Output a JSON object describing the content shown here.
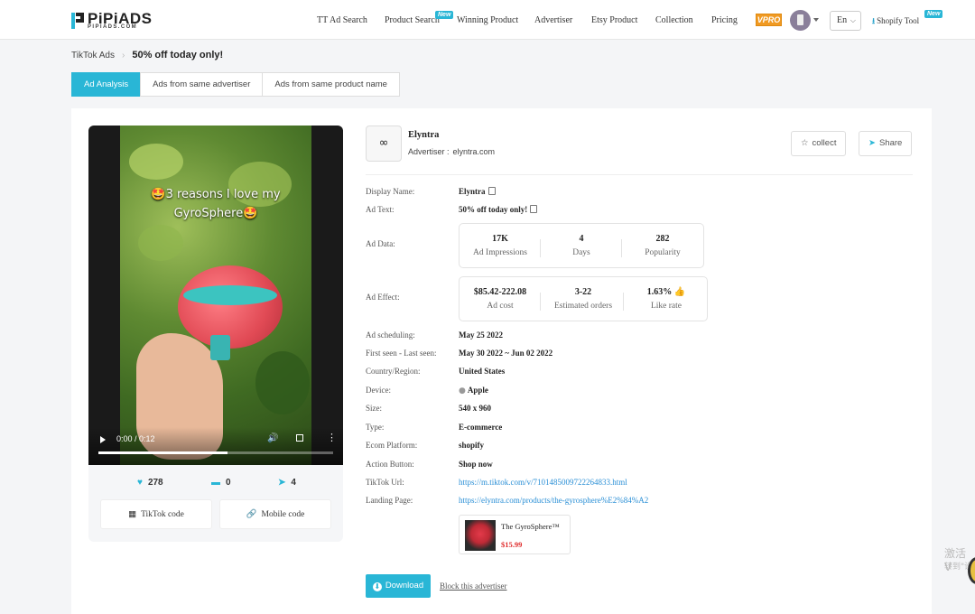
{
  "brand": {
    "name": "PiPiADS",
    "sub": "PIPIADS.COM"
  },
  "nav": {
    "items": [
      "TT Ad Search",
      "Product Search",
      "Winning Product",
      "Advertiser",
      "Etsy Product",
      "Collection",
      "Pricing"
    ],
    "new_badge": "New",
    "vip_label": "VPRO",
    "lang": "En",
    "lang_caret": "⌵",
    "shopify_label": "Shopify Tool",
    "shopify_new": "New"
  },
  "breadcrumb": {
    "root": "TikTok Ads",
    "separator": "›",
    "current": "50% off today only!"
  },
  "tabs": [
    "Ad Analysis",
    "Ads from same advertiser",
    "Ads from same product name"
  ],
  "video": {
    "caption_line1": "🤩3 reasons I love my",
    "caption_line2": "GyroSphere🤩",
    "time": "0:00 / 0:12",
    "progress": 0.55
  },
  "engagement": {
    "likes": "278",
    "comments": "0",
    "shares": "4"
  },
  "code_buttons": {
    "tiktok": "TikTok code",
    "mobile": "Mobile code"
  },
  "advertiser": {
    "logo_glyph": "∞",
    "name": "Elyntra",
    "label": "Advertiser :",
    "domain": "elyntra.com"
  },
  "actions": {
    "collect": "collect",
    "share": "Share"
  },
  "details": {
    "display_name_label": "Display Name:",
    "display_name": "Elyntra",
    "ad_text_label": "Ad Text:",
    "ad_text": "50% off today only!",
    "ad_data_label": "Ad Data:",
    "ad_effect_label": "Ad Effect:",
    "scheduling_label": "Ad scheduling:",
    "scheduling": "May 25 2022",
    "seen_label": "First seen - Last seen:",
    "seen": "May 30 2022 ~ Jun 02 2022",
    "country_label": "Country/Region:",
    "country": "United States",
    "device_label": "Device:",
    "device": "Apple",
    "size_label": "Size:",
    "size": "540 x 960",
    "type_label": "Type:",
    "type": "E-commerce",
    "platform_label": "Ecom Platform:",
    "platform": "shopify",
    "action_label": "Action Button:",
    "action": "Shop now",
    "tiktok_url_label": "TikTok Url:",
    "tiktok_url": "https://m.tiktok.com/v/7101485009722264833.html",
    "landing_label": "Landing Page:",
    "landing_url": "https://elyntra.com/products/the-gyrosphere%E2%84%A2"
  },
  "ad_data": [
    {
      "value": "17K",
      "label": "Ad Impressions"
    },
    {
      "value": "4",
      "label": "Days"
    },
    {
      "value": "282",
      "label": "Popularity"
    }
  ],
  "ad_effect": [
    {
      "value": "$85.42-222.08",
      "label": "Ad cost"
    },
    {
      "value": "3-22",
      "label": "Estimated orders"
    },
    {
      "value": "1.63%",
      "label": "Like rate"
    }
  ],
  "product": {
    "name": "The GyroSphere™",
    "price": "$15.99"
  },
  "footer_actions": {
    "download": "Download",
    "block": "Block this advertiser"
  },
  "watermark": {
    "line1": "激活 V",
    "line2": "转到\"设"
  },
  "colors": {
    "accent": "#29b6d6",
    "price": "#e02d2d",
    "link": "#2a8fd6"
  }
}
